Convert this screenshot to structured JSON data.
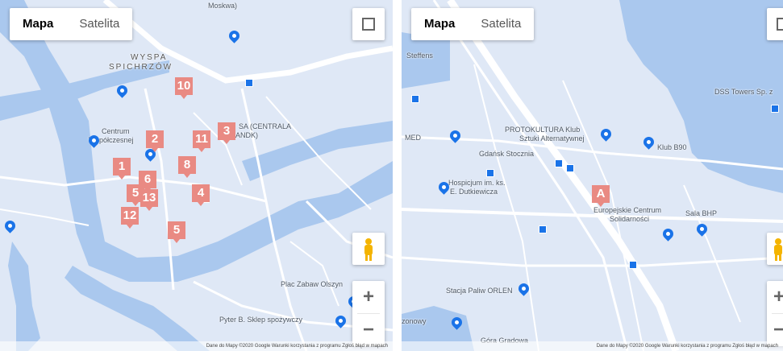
{
  "map1": {
    "maptype": {
      "map": "Mapa",
      "satellite": "Satelita"
    },
    "zoom": {
      "in": "+",
      "out": "−"
    },
    "markers": [
      "10",
      "2",
      "3",
      "11",
      "8",
      "1",
      "6",
      "5",
      "13",
      "4",
      "12",
      "5"
    ],
    "labels": {
      "moskwa": "Moskwa)",
      "wyspa": "WYSPA",
      "spichrzow": "SPICHRZÓW",
      "centrum": "Centrum",
      "wspolczesne": "Współczesnej",
      "sa": "SA (CENTRALA",
      "andk": "ANDK)",
      "plac": "Plac Zabaw Olszyn",
      "pyter": "Pyter B. Sklep spożywczy"
    },
    "footer": "Dane do Mapy ©2020 Google  Warunki korzystania z programu  Zgłoś błąd w mapach"
  },
  "map2": {
    "maptype": {
      "map": "Mapa",
      "satellite": "Satelita"
    },
    "zoom": {
      "in": "+",
      "out": "−"
    },
    "markers": [
      "A"
    ],
    "labels": {
      "sieferna": "Steffens",
      "protokultura1": "PROTOKULTURA Klub",
      "protokultura2": "Sztuki Alternatywnej",
      "gdansk": "Gdańsk Stocznia",
      "hospicjum1": "Hospicjum im. ks.",
      "hospicjum2": "E. Dutkiewicza",
      "klub": "Klub B90",
      "ecs1": "Europejskie Centrum",
      "ecs2": "Solidarności",
      "sala": "Sala BHP",
      "dss": "DSS Towers Sp. z",
      "stacja": "Stacja Paliw ORLEN",
      "gora": "Góra Gradowa",
      "med": "MED",
      "zonowy": "zonowy"
    },
    "footer": "Dane do Mapy ©2020 Google  Warunki korzystania z programu  Zgłoś błąd w mapach"
  },
  "colors": {
    "marker": "#e98a83",
    "water": "#aac8ee",
    "land": "#dfe8f6",
    "road": "#ffffff",
    "poi": "#1a73e8"
  }
}
